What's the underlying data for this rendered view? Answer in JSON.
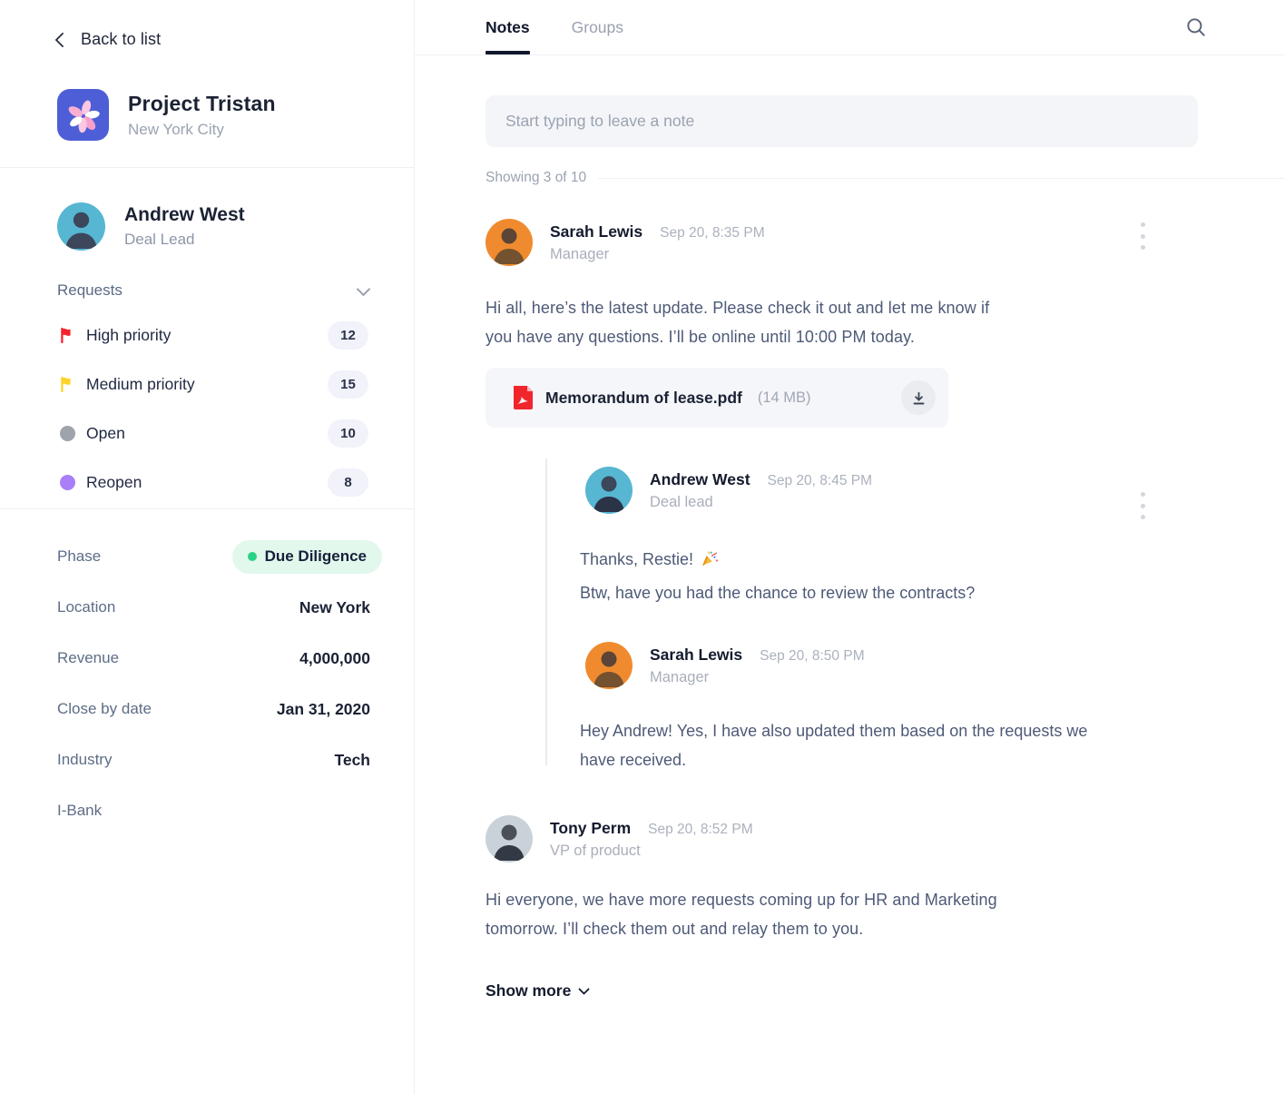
{
  "colors": {
    "logo_blue": "#4e5ed6",
    "high_priority_red": "#f7232c",
    "medium_priority_yellow": "#fdd32a",
    "open_gray": "#9fa3ab",
    "reopen_purple": "#a87ff8",
    "phase_green": "#28d284",
    "phase_badge_bg": "#e2f8ec",
    "pdf_red": "#f0262c",
    "avatar_andrew_bg": "#57b6d1",
    "avatar_sarah_bg": "#ef8b2e",
    "avatar_tony_bg": "#c9d2d8"
  },
  "sidebar": {
    "back_label": "Back to list",
    "project": {
      "title": "Project Tristan",
      "subtitle": "New York City",
      "logo_icon": "flower-icon"
    },
    "lead": {
      "name": "Andrew West",
      "role": "Deal Lead"
    },
    "requests": {
      "label": "Requests",
      "items": [
        {
          "icon": "flag-icon",
          "label": "High priority",
          "count": "12"
        },
        {
          "icon": "flag-icon",
          "label": "Medium priority",
          "count": "15"
        },
        {
          "icon": "dot-icon",
          "label": "Open",
          "count": "10"
        },
        {
          "icon": "dot-icon",
          "label": "Reopen",
          "count": "8"
        }
      ]
    },
    "details": [
      {
        "label": "Phase",
        "value": "Due Diligence",
        "style": "green-badge"
      },
      {
        "label": "Location",
        "value": "New York"
      },
      {
        "label": "Revenue",
        "value": "4,000,000"
      },
      {
        "label": "Close by date",
        "value": "Jan 31, 2020"
      },
      {
        "label": "Industry",
        "value": "Tech"
      },
      {
        "label": "I-Bank",
        "value": ""
      }
    ]
  },
  "header": {
    "tabs": [
      {
        "label": "Notes",
        "active": true
      },
      {
        "label": "Groups",
        "active": false
      }
    ],
    "search_icon": "search-icon"
  },
  "composer": {
    "placeholder": "Start typing to leave a note"
  },
  "feed": {
    "showing": "Showing 3 of 10",
    "notes": [
      {
        "author": "Sarah Lewis",
        "role": "Manager",
        "time": "Sep 20, 8:35 PM",
        "body": [
          "Hi all, here’s the latest update. Please check it out and let me know if",
          "you have any questions. I’ll be online until 10:00 PM today."
        ],
        "attachment": {
          "icon": "pdf-file-icon",
          "name": "Memorandum of lease.pdf",
          "size": "(14 MB)",
          "action_icon": "download-icon"
        },
        "replies": [
          {
            "author": "Andrew West",
            "role": "Deal lead",
            "time": "Sep 20, 8:45 PM",
            "body": [
              "Thanks, Restie!",
              "Btw, have you had the chance to review the contracts?"
            ],
            "emoji_after_line_1": "party-popper"
          },
          {
            "author": "Sarah Lewis",
            "role": "Manager",
            "time": "Sep 20, 8:50 PM",
            "body": [
              "Hey Andrew! Yes, I have also updated them based on the requests we",
              "have received."
            ]
          }
        ]
      },
      {
        "author": "Tony Perm",
        "role": "VP of product",
        "time": "Sep 20, 8:52 PM",
        "body": [
          "Hi everyone, we have more requests coming up for HR and Marketing",
          "tomorrow. I’ll check them out and relay them to you."
        ]
      }
    ],
    "show_more_label": "Show more"
  }
}
